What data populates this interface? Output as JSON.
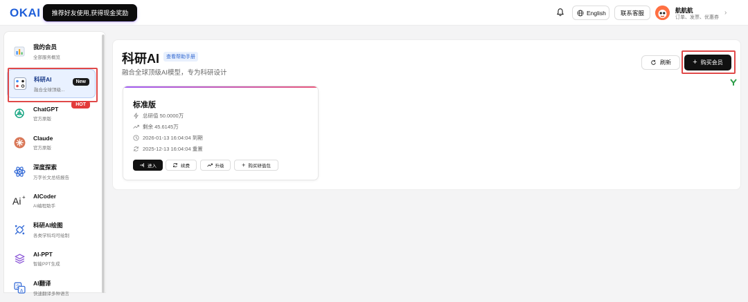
{
  "header": {
    "logo": "OKAI",
    "promo": "推荐好友使用,获得现金奖励",
    "language": "English",
    "contact": "联系客服",
    "user_name": "航航航",
    "user_sub": "订单、发票、优惠券"
  },
  "sidebar": {
    "items": [
      {
        "title": "我的会员",
        "sub": "全部服务概览",
        "icon": "bar-chart-icon"
      },
      {
        "title": "科研AI",
        "sub": "融合全球顶级...",
        "icon": "research-ai-icon",
        "badge": "New"
      },
      {
        "title": "ChatGPT",
        "sub": "官方原版",
        "icon": "openai-icon",
        "badge": "HOT"
      },
      {
        "title": "Claude",
        "sub": "官方原版",
        "icon": "claude-icon"
      },
      {
        "title": "深度探索",
        "sub": "万字长文总结报告",
        "icon": "atom-icon"
      },
      {
        "title": "AICoder",
        "sub": "AI编程助手",
        "icon": "ai-coder-icon"
      },
      {
        "title": "科研AI绘图",
        "sub": "各类学科均可绘制",
        "icon": "drawing-icon"
      },
      {
        "title": "AI-PPT",
        "sub": "智能PPT生成",
        "icon": "layers-icon"
      },
      {
        "title": "AI翻译",
        "sub": "快速翻译多种语言",
        "icon": "translate-icon"
      }
    ]
  },
  "main": {
    "title": "科研AI",
    "help": "查看帮助手册",
    "subtitle": "融合全球顶级AI模型，专为科研设计",
    "refresh": "刷新",
    "buy": "购买会员"
  },
  "plan": {
    "name": "标准版",
    "total": "总研值 50.0000万",
    "remaining": "剩余 45.6145万",
    "expire": "2026-01-13 16:04:04 到期",
    "reset": "2025-12-13 16:04:04 重置",
    "buttons": {
      "enter": "进入",
      "renew": "续费",
      "upgrade": "升级",
      "buy_pack": "购买研值包"
    }
  },
  "colors": {
    "accent": "#1f5fd9",
    "highlight": "#e04848"
  }
}
